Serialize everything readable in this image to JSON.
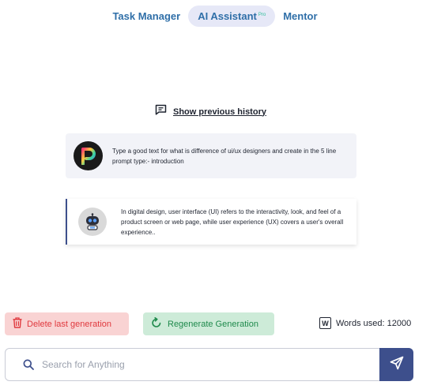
{
  "tabs": [
    {
      "label": "Task Manager",
      "active": false
    },
    {
      "label": "AI Assistant",
      "badge": "Pro",
      "active": true
    },
    {
      "label": "Mentor",
      "active": false
    }
  ],
  "history": {
    "label": "Show previous history",
    "icon": "chat-icon"
  },
  "prompt": {
    "text": "Type a good text for what is difference  of ui/ux designers  and create in the 5 line prompt type:- introduction",
    "avatar_icon": "p-logo-icon"
  },
  "response": {
    "text": "In digital design, user interface (UI) refers to the interactivity, look, and feel of a product screen or web page, while user experience (UX) covers a user's overall experience..",
    "avatar_icon": "robot-icon"
  },
  "actions": {
    "delete_label": "Delete last generation",
    "regenerate_label": "Regenerate Generation",
    "words_used": "Words used: 12000",
    "words_icon_letter": "W"
  },
  "search": {
    "placeholder": "Search for Anything",
    "value": ""
  },
  "colors": {
    "accent": "#3d4f8c",
    "tab_text": "#2f6fa8",
    "delete_bg": "#f9d3d3",
    "delete_text": "#e0393e",
    "regen_bg": "#cdebd8",
    "regen_text": "#1f8a4c"
  }
}
